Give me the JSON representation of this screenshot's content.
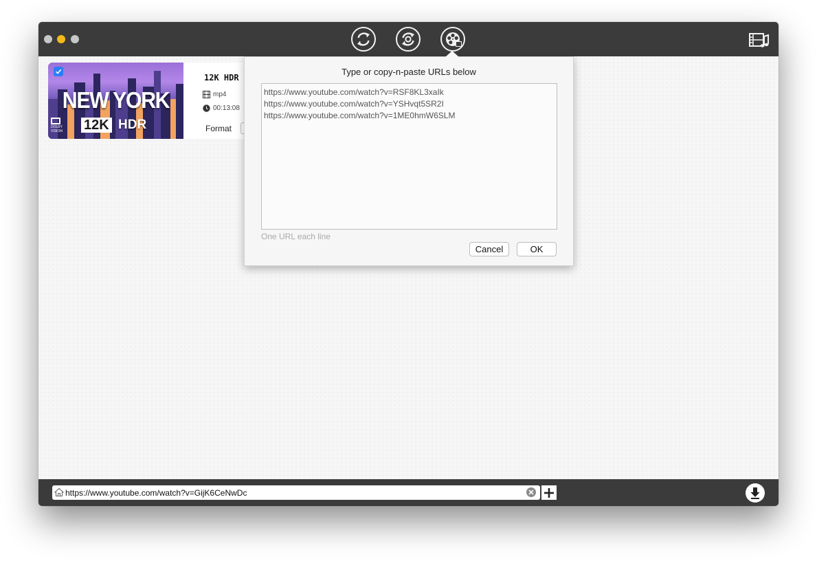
{
  "toolbar": {
    "buttons": [
      {
        "name": "convert-icon"
      },
      {
        "name": "rotate-icon"
      },
      {
        "name": "film-reel-icon"
      }
    ],
    "media_icon": "film-music-icon"
  },
  "video": {
    "checked": true,
    "title": "12K HDR",
    "ext": "mp4",
    "duration": "00:13:08",
    "format_label": "Format",
    "thumbnail": {
      "headline": "NEW YORK",
      "badge_12k": "12K",
      "badge_hdr": "HDR",
      "dolby_line1": "DOLBY",
      "dolby_line2": "VISION"
    }
  },
  "popover": {
    "title": "Type or copy-n-paste URLs below",
    "urls": [
      "https://www.youtube.com/watch?v=RSF8KL3xaIk",
      "https://www.youtube.com/watch?v=YSHvqt5SR2I",
      "https://www.youtube.com/watch?v=1ME0hmW6SLM"
    ],
    "hint": "One URL each line",
    "cancel_label": "Cancel",
    "ok_label": "OK"
  },
  "bottombar": {
    "url_value": "https://www.youtube.com/watch?v=GijK6CeNwDc"
  },
  "colors": {
    "titlebar": "#3b3b3b",
    "accent": "#2d7cf6",
    "traffic_min": "#f5b91a"
  }
}
